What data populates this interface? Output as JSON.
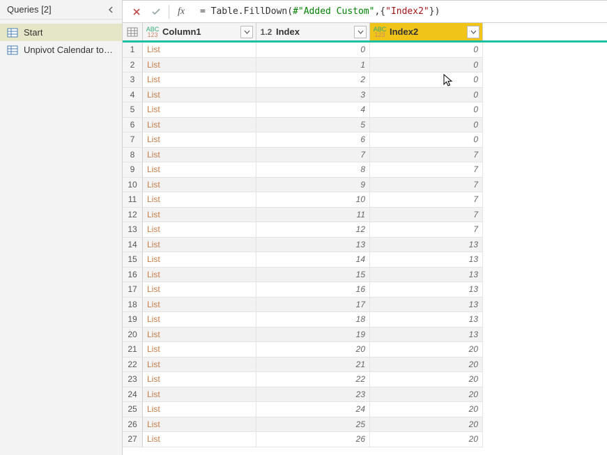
{
  "sidebar": {
    "title": "Queries [2]",
    "items": [
      {
        "label": "Start",
        "selected": true
      },
      {
        "label": "Unpivot Calendar to T...",
        "selected": false
      }
    ]
  },
  "formula": {
    "prefix": "=",
    "parts": {
      "fn": " Table.FillDown",
      "open": "(",
      "hashid": "#\"Added Custom\"",
      "comma": ",{",
      "str": "\"Index2\"",
      "close": "})"
    }
  },
  "columns": {
    "c1": {
      "name": "Column1",
      "type": "ABC\n123"
    },
    "c2": {
      "name": "Index",
      "type": "1.2"
    },
    "c3": {
      "name": "Index2",
      "type": "ABC\n123"
    }
  },
  "rows": [
    {
      "n": "1",
      "c1": "List",
      "c2": "0",
      "c3": "0"
    },
    {
      "n": "2",
      "c1": "List",
      "c2": "1",
      "c3": "0"
    },
    {
      "n": "3",
      "c1": "List",
      "c2": "2",
      "c3": "0"
    },
    {
      "n": "4",
      "c1": "List",
      "c2": "3",
      "c3": "0"
    },
    {
      "n": "5",
      "c1": "List",
      "c2": "4",
      "c3": "0"
    },
    {
      "n": "6",
      "c1": "List",
      "c2": "5",
      "c3": "0"
    },
    {
      "n": "7",
      "c1": "List",
      "c2": "6",
      "c3": "0"
    },
    {
      "n": "8",
      "c1": "List",
      "c2": "7",
      "c3": "7"
    },
    {
      "n": "9",
      "c1": "List",
      "c2": "8",
      "c3": "7"
    },
    {
      "n": "10",
      "c1": "List",
      "c2": "9",
      "c3": "7"
    },
    {
      "n": "11",
      "c1": "List",
      "c2": "10",
      "c3": "7"
    },
    {
      "n": "12",
      "c1": "List",
      "c2": "11",
      "c3": "7"
    },
    {
      "n": "13",
      "c1": "List",
      "c2": "12",
      "c3": "7"
    },
    {
      "n": "14",
      "c1": "List",
      "c2": "13",
      "c3": "13"
    },
    {
      "n": "15",
      "c1": "List",
      "c2": "14",
      "c3": "13"
    },
    {
      "n": "16",
      "c1": "List",
      "c2": "15",
      "c3": "13"
    },
    {
      "n": "17",
      "c1": "List",
      "c2": "16",
      "c3": "13"
    },
    {
      "n": "18",
      "c1": "List",
      "c2": "17",
      "c3": "13"
    },
    {
      "n": "19",
      "c1": "List",
      "c2": "18",
      "c3": "13"
    },
    {
      "n": "20",
      "c1": "List",
      "c2": "19",
      "c3": "13"
    },
    {
      "n": "21",
      "c1": "List",
      "c2": "20",
      "c3": "20"
    },
    {
      "n": "22",
      "c1": "List",
      "c2": "21",
      "c3": "20"
    },
    {
      "n": "23",
      "c1": "List",
      "c2": "22",
      "c3": "20"
    },
    {
      "n": "24",
      "c1": "List",
      "c2": "23",
      "c3": "20"
    },
    {
      "n": "25",
      "c1": "List",
      "c2": "24",
      "c3": "20"
    },
    {
      "n": "26",
      "c1": "List",
      "c2": "25",
      "c3": "20"
    },
    {
      "n": "27",
      "c1": "List",
      "c2": "26",
      "c3": "20"
    }
  ]
}
